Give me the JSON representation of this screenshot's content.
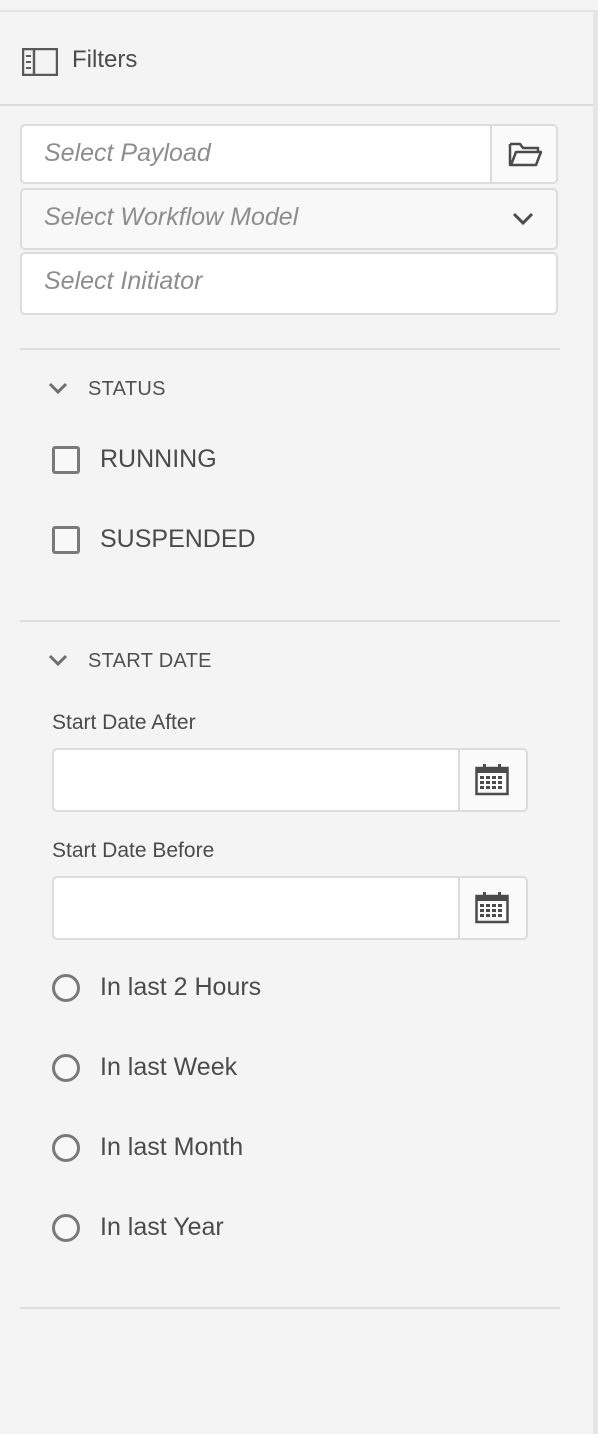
{
  "header": {
    "title": "Filters",
    "icon": "sidebar-panel-icon"
  },
  "fields": {
    "payload_placeholder": "Select Payload",
    "payload_icon": "folder-icon",
    "model_placeholder": "Select Workflow Model",
    "model_icon": "chevron-down-icon",
    "initiator_placeholder": "Select Initiator"
  },
  "status": {
    "title": "STATUS",
    "options": [
      {
        "label": "RUNNING",
        "checked": false
      },
      {
        "label": "SUSPENDED",
        "checked": false
      }
    ]
  },
  "start_date": {
    "title": "START DATE",
    "after_label": "Start Date After",
    "after_value": "",
    "before_label": "Start Date Before",
    "before_value": "",
    "calendar_icon": "calendar-icon",
    "ranges": [
      {
        "label": "In last 2 Hours",
        "selected": false
      },
      {
        "label": "In last Week",
        "selected": false
      },
      {
        "label": "In last Month",
        "selected": false
      },
      {
        "label": "In last Year",
        "selected": false
      }
    ]
  }
}
